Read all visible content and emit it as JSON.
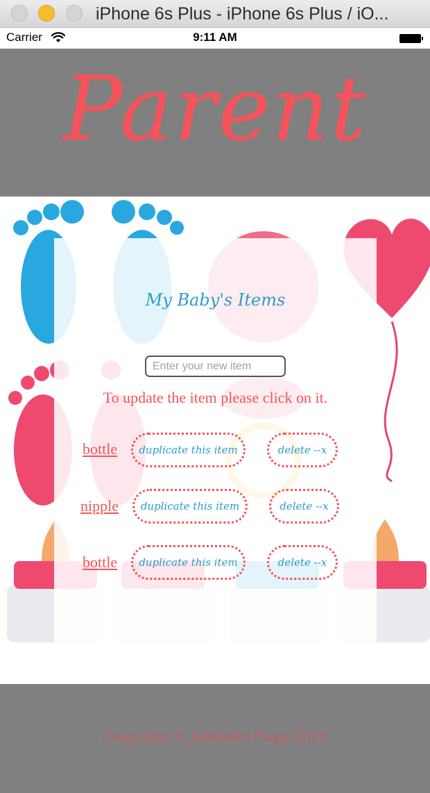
{
  "window": {
    "title": "iPhone 6s Plus - iPhone 6s Plus / iO..."
  },
  "status_bar": {
    "carrier": "Carrier",
    "time": "9:11 AM",
    "icons": [
      "wifi-icon",
      "battery-icon"
    ]
  },
  "header": {
    "title": "Parent"
  },
  "main": {
    "section_title": "My Baby's Items",
    "input_placeholder": "Enter your new item",
    "hint": "To update the item please click on it.",
    "items": [
      {
        "name": "bottle",
        "duplicate_label": "duplicate this item",
        "delete_label": "delete --x"
      },
      {
        "name": "nipple",
        "duplicate_label": "duplicate this item",
        "delete_label": "delete --x"
      },
      {
        "name": "bottle",
        "duplicate_label": "duplicate this item",
        "delete_label": "delete --x"
      }
    ]
  },
  "footer": {
    "copyright": "Copyright © Jahdiahe Flapy 2016"
  },
  "colors": {
    "accent_red": "#f2545b",
    "accent_blue": "#2a9dc7",
    "band_gray": "#808080"
  }
}
